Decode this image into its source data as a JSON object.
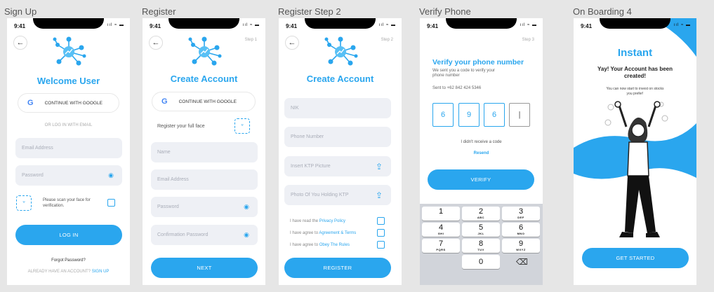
{
  "frames": [
    {
      "label": "Sign Up"
    },
    {
      "label": "Register"
    },
    {
      "label": "Register Step 2"
    },
    {
      "label": "Verify Phone"
    },
    {
      "label": "On Boarding 4"
    }
  ],
  "status": {
    "time": "9:41",
    "icons": "ııl ≈ ▬"
  },
  "signup": {
    "title": "Welcome User",
    "google": "CONTINUE WITH GOOGLE",
    "or_email": "OR LOG IN WITH EMAIL",
    "email_placeholder": "Email Address",
    "password_placeholder": "Password",
    "scan_text": "Please scan your face for verification.",
    "login": "LOG IN",
    "forgot": "Forgot Password?",
    "have_account": "ALREADY HAVE AN ACCOUNT?",
    "signup_link": "SIGN UP"
  },
  "register": {
    "step": "Step 1",
    "title": "Create Account",
    "google": "CONTINUE WITH GOOGLE",
    "face_text": "Register your full face",
    "name": "Name",
    "email": "Email Address",
    "password": "Password",
    "confirm": "Confirmation Password",
    "next": "NEXT"
  },
  "register2": {
    "step": "Step 2",
    "title": "Create Account",
    "nik": "NIK",
    "phone": "Phone Number",
    "ktp": "Insert KTP Picture",
    "photo": "Photo Of You Holding KTP",
    "agree1_prefix": "I have read the",
    "agree1_link": "Privacy Policy",
    "agree2_prefix": "I have agree to",
    "agree2_link": "Agreement & Terms",
    "agree3_prefix": "I have agree to",
    "agree3_link": "Obey The Rules",
    "register": "REGISTER"
  },
  "verify": {
    "step": "Step 3",
    "title": "Verify your phone number",
    "sub": "We sent you a code to verify your phone number",
    "sent_to": "Sent to +62 842 424 5346",
    "digits": [
      "6",
      "9",
      "6",
      "|"
    ],
    "no_code": "I didn't receive a code",
    "resend": "Resend",
    "verify": "VERIFY",
    "keys": [
      {
        "n": "1",
        "l": ""
      },
      {
        "n": "2",
        "l": "ABC"
      },
      {
        "n": "3",
        "l": "DEF"
      },
      {
        "n": "4",
        "l": "GHI"
      },
      {
        "n": "5",
        "l": "JKL"
      },
      {
        "n": "6",
        "l": "MNO"
      },
      {
        "n": "7",
        "l": "PQRS"
      },
      {
        "n": "8",
        "l": "TUV"
      },
      {
        "n": "9",
        "l": "WXYZ"
      },
      {
        "n": "0",
        "l": ""
      }
    ]
  },
  "onboarding": {
    "title": "Instant",
    "subtitle": "Yay! Your Account has been created!",
    "desc": "You can now start to invest on stocks you prefer!",
    "cta": "GET STARTED"
  }
}
